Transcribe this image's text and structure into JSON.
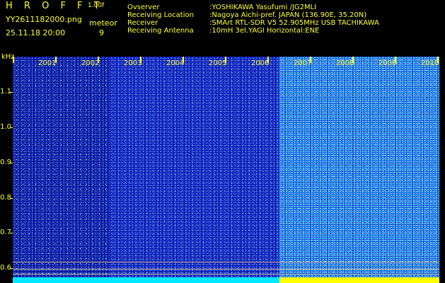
{
  "header": {
    "title": "H R O F F T",
    "version": "1.00f",
    "filename": "YY2611182000.png",
    "datetime": "25.11.18 20:00",
    "meteor_label": "meteor",
    "meteor_count": "9"
  },
  "info": {
    "rows": [
      {
        "key": "Ovserver",
        "value": ":YOSHIKAWA Yasufumi /JG2MLI"
      },
      {
        "key": "Receiving Location",
        "value": ":Nagoya Aichi-pref. JAPAN (136.90E, 35.20N)"
      },
      {
        "key": "Receiver",
        "value": ":SMArt RTL-SDR V5 52.905MHz USB TACHIKAWA"
      },
      {
        "key": "Receiving Antenna",
        "value": ":10mH 3el.YAGI Horizontal:ENE"
      }
    ]
  },
  "axis": {
    "unit": "kHz",
    "ticks": [
      "1.1",
      "1.0",
      "0.9",
      "0.8",
      "0.7",
      "0.6"
    ]
  },
  "years": [
    "2001",
    "2002",
    "2003",
    "2004",
    "2005",
    "2006",
    "2007",
    "2008",
    "2009",
    "2010"
  ],
  "colors": {
    "text": "#ffff33",
    "bg_dark": "#0c1a9a",
    "bg_mid": "#1020b4",
    "bg_bright": "#1a56e0",
    "bar_left": "#00e8ff",
    "bar_right": "#ffff00"
  }
}
